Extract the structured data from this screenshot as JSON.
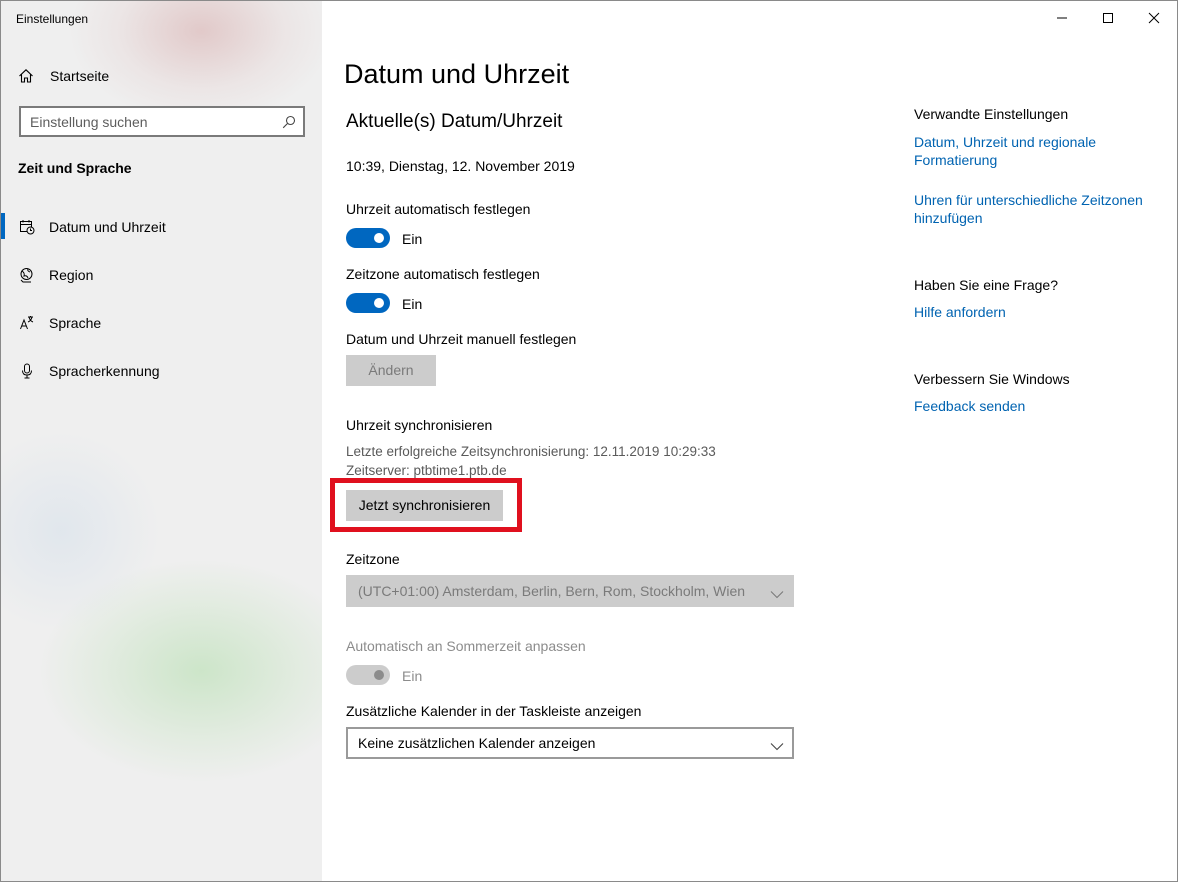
{
  "window": {
    "title": "Einstellungen",
    "controls": {
      "minimize": "minimize-icon",
      "maximize": "maximize-icon",
      "close": "close-icon"
    }
  },
  "sidebar": {
    "home_label": "Startseite",
    "search_placeholder": "Einstellung suchen",
    "section_title": "Zeit und Sprache",
    "items": [
      {
        "label": "Datum und Uhrzeit",
        "icon": "date-time-icon",
        "active": true
      },
      {
        "label": "Region",
        "icon": "globe-icon",
        "active": false
      },
      {
        "label": "Sprache",
        "icon": "language-icon",
        "active": false
      },
      {
        "label": "Spracherkennung",
        "icon": "microphone-icon",
        "active": false
      }
    ]
  },
  "main": {
    "title": "Datum und Uhrzeit",
    "current_heading": "Aktuelle(s) Datum/Uhrzeit",
    "current_datetime": "10:39, Dienstag, 12. November 2019",
    "auto_time": {
      "label": "Uhrzeit automatisch festlegen",
      "state": "Ein"
    },
    "auto_timezone": {
      "label": "Zeitzone automatisch festlegen",
      "state": "Ein"
    },
    "manual": {
      "label": "Datum und Uhrzeit manuell festlegen",
      "button": "Ändern"
    },
    "sync": {
      "heading": "Uhrzeit synchronisieren",
      "last_sync": "Letzte erfolgreiche Zeitsynchronisierung: 12.11.2019 10:29:33",
      "server": "Zeitserver: ptbtime1.ptb.de",
      "button": "Jetzt synchronisieren"
    },
    "timezone": {
      "label": "Zeitzone",
      "value": "(UTC+01:00) Amsterdam, Berlin, Bern, Rom, Stockholm, Wien"
    },
    "dst": {
      "label": "Automatisch an Sommerzeit anpassen",
      "state": "Ein"
    },
    "calendar": {
      "label": "Zusätzliche Kalender in der Taskleiste anzeigen",
      "value": "Keine zusätzlichen Kalender anzeigen"
    }
  },
  "related": {
    "heading": "Verwandte Einstellungen",
    "link1": "Datum, Uhrzeit und regionale Formatierung",
    "link2": "Uhren für unterschiedliche Zeitzonen hinzufügen",
    "question_heading": "Haben Sie eine Frage?",
    "help_link": "Hilfe anfordern",
    "improve_heading": "Verbessern Sie Windows",
    "feedback_link": "Feedback senden"
  },
  "colors": {
    "accent": "#0067c0",
    "link": "#0063b1",
    "highlight": "#e0101e",
    "disabled": "#cccccc"
  }
}
